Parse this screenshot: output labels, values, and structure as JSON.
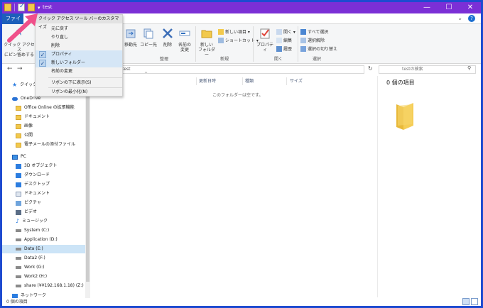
{
  "window": {
    "title": "test",
    "min_symbol": "—",
    "max_symbol": "☐",
    "close_symbol": "✕",
    "title_bar_color": "#7b2fd6"
  },
  "ribbon_tabs": {
    "file": "ファイル"
  },
  "ribbon": {
    "pin_label_1": "クイック アクセス",
    "pin_label_2": "にピン留めする",
    "move_to": "移動先",
    "copy_to": "コピー先",
    "delete": "削除",
    "rename_1": "名前の",
    "rename_2": "変更",
    "new_folder_1": "新しい",
    "new_folder_2": "フォルダー",
    "new_item": "新しい項目 ▾",
    "shortcut": "ショートカット ▾",
    "properties": "プロパティ",
    "open": "開く ▾",
    "edit": "編集",
    "history": "履歴",
    "select_all": "すべて選択",
    "select_none": "選択解除",
    "invert_selection": "選択の切り替え",
    "group_organize": "整理",
    "group_new": "新規",
    "group_open": "開く",
    "group_select": "選択"
  },
  "address": {
    "path": "test",
    "search_placeholder": "testの検索"
  },
  "columns": {
    "modified": "更新日時",
    "type": "種類",
    "size": "サイズ"
  },
  "main": {
    "empty_message": "このフォルダーは空です。",
    "preview_title": "0 個の項目"
  },
  "nav_pane": {
    "quick_access": "クイック",
    "onedrive": "OneDrive",
    "items": [
      "Office Online の拡張機能",
      "ドキュメント",
      "画像",
      "公開",
      "電子メールの添付ファイル"
    ],
    "pc": "PC",
    "pc_items": [
      "3D オブジェクト",
      "ダウンロード",
      "デスクトップ",
      "ドキュメント",
      "ピクチャ",
      "ビデオ",
      "ミュージック",
      "System (C:)",
      "Application (D:)",
      "Data (E:)",
      "Data2 (F:)",
      "Work (G:)",
      "Work2 (H:)",
      "share (¥¥192.168.1.18) (Z:)"
    ],
    "network": "ネットワーク"
  },
  "status": {
    "item_count": "0 個の項目"
  },
  "qat_menu": {
    "header": "クイック アクセス ツール バーのカスタマイズ",
    "items": [
      {
        "label": "元に戻す",
        "checked": false
      },
      {
        "label": "やり直し",
        "checked": false
      },
      {
        "label": "削除",
        "checked": false
      },
      {
        "label": "プロパティ",
        "checked": true
      },
      {
        "label": "新しいフォルダー",
        "checked": true
      },
      {
        "label": "名前の変更",
        "checked": false
      }
    ],
    "show_below": "リボンの下に表示(S)",
    "minimize": "リボンの最小化(N)"
  },
  "colors": {
    "accent": "#1c5fba",
    "arrow": "#f0508a",
    "folder": "#f2c94c"
  }
}
